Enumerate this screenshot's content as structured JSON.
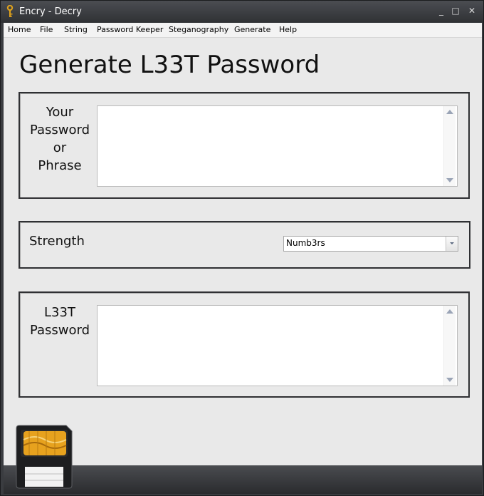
{
  "window": {
    "title": "Encry - Decry",
    "minimize": "_",
    "maximize": "□",
    "close": "✕"
  },
  "menu": [
    "Home",
    "File",
    "String",
    "Password Keeper",
    "Steganography",
    "Generate",
    "Help"
  ],
  "page": {
    "heading": "Generate L33T Password"
  },
  "password_group": {
    "label_lines": [
      "Your",
      "Password",
      "or",
      "Phrase"
    ],
    "value": ""
  },
  "strength_group": {
    "label": "Strength",
    "selected": "Numb3rs"
  },
  "output_group": {
    "label_lines": [
      "L33T",
      "Password"
    ],
    "value": ""
  },
  "colors": {
    "frame": "#2f3033",
    "background": "#e9e9e9",
    "titlebar": "#3a3c40"
  }
}
